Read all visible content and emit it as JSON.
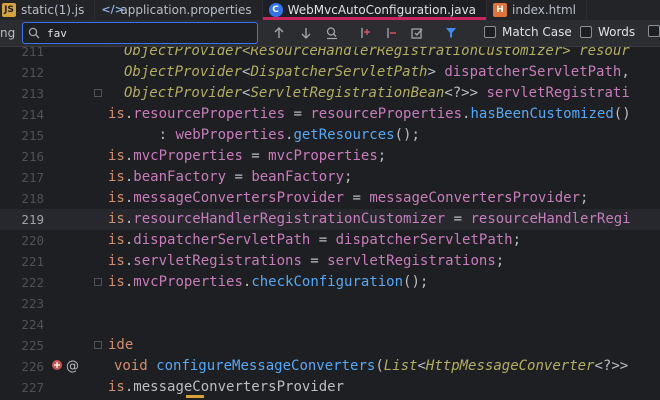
{
  "tabs": [
    {
      "label": "static(1).js",
      "icon": "js-file-icon",
      "icon_text": "JS",
      "active": false
    },
    {
      "label": "application.properties",
      "icon": "properties-file-icon",
      "icon_text": "</>",
      "active": false
    },
    {
      "label": "WebMvcAutoConfiguration.java",
      "icon": "java-class-icon",
      "icon_text": "C",
      "active": true
    },
    {
      "label": "index.html",
      "icon": "html-file-icon",
      "icon_text": "H",
      "active": false
    }
  ],
  "findbar": {
    "left_label": "ng",
    "query": "fav",
    "match_case_label": "Match Case",
    "words_label": "Words",
    "match_case_checked": false,
    "words_checked": false
  },
  "colors": {
    "background": "#1e1f22",
    "accent": "#3574f0",
    "active_tab_underline": "#c9245d",
    "keyword": "#cf8e6d",
    "field": "#c77dbb",
    "method": "#56a8f5",
    "type": "#b3ae60"
  },
  "editor": {
    "current_line": "219",
    "lines": [
      {
        "num": "211",
        "tokens": [
          [
            "ty",
            "ObjectProvider<ResourceHandlerRegistrationCustomizer> resour"
          ]
        ]
      },
      {
        "num": "212",
        "tokens": [
          [
            "ty",
            "ObjectProvider"
          ],
          [
            "pl",
            "<"
          ],
          [
            "ty",
            "DispatcherServletPath"
          ],
          [
            "pl",
            "> "
          ],
          [
            "fld",
            "dispatcherServletPath"
          ],
          [
            "pl",
            ","
          ]
        ]
      },
      {
        "num": "213",
        "tokens": [
          [
            "ty",
            "ObjectProvider"
          ],
          [
            "pl",
            "<"
          ],
          [
            "ty",
            "ServletRegistrationBean"
          ],
          [
            "pl",
            "<?>> "
          ],
          [
            "fld",
            "servletRegistrati"
          ]
        ]
      },
      {
        "num": "214",
        "tokens": [
          [
            "kw",
            "is"
          ],
          [
            "pl",
            "."
          ],
          [
            "fld",
            "resourceProperties"
          ],
          [
            "pl",
            " = "
          ],
          [
            "fld",
            "resourceProperties"
          ],
          [
            "pl",
            "."
          ],
          [
            "mth",
            "hasBeenCustomized"
          ],
          [
            "pl",
            "()"
          ]
        ]
      },
      {
        "num": "215",
        "tokens": [
          [
            "pl",
            "      : "
          ],
          [
            "fld",
            "webProperties"
          ],
          [
            "pl",
            "."
          ],
          [
            "mth",
            "getResources"
          ],
          [
            "pl",
            "();"
          ]
        ]
      },
      {
        "num": "216",
        "tokens": [
          [
            "kw",
            "is"
          ],
          [
            "pl",
            "."
          ],
          [
            "fld",
            "mvcProperties"
          ],
          [
            "pl",
            " = "
          ],
          [
            "fld",
            "mvcProperties"
          ],
          [
            "pl",
            ";"
          ]
        ]
      },
      {
        "num": "217",
        "tokens": [
          [
            "kw",
            "is"
          ],
          [
            "pl",
            "."
          ],
          [
            "fld",
            "beanFactory"
          ],
          [
            "pl",
            " = "
          ],
          [
            "fld",
            "beanFactory"
          ],
          [
            "pl",
            ";"
          ]
        ]
      },
      {
        "num": "218",
        "tokens": [
          [
            "kw",
            "is"
          ],
          [
            "pl",
            "."
          ],
          [
            "fld",
            "messageConvertersProvider"
          ],
          [
            "pl",
            " = "
          ],
          [
            "fld",
            "messageConvertersProvider"
          ],
          [
            "pl",
            ";"
          ]
        ]
      },
      {
        "num": "219",
        "tokens": [
          [
            "kw",
            "is"
          ],
          [
            "pl",
            "."
          ],
          [
            "fld",
            "resourceHandlerRegistrationCustomizer"
          ],
          [
            "pl",
            " = "
          ],
          [
            "fld",
            "resourceHandlerRegi"
          ]
        ]
      },
      {
        "num": "220",
        "tokens": [
          [
            "kw",
            "is"
          ],
          [
            "pl",
            "."
          ],
          [
            "fld",
            "dispatcherServletPath"
          ],
          [
            "pl",
            " = "
          ],
          [
            "fld",
            "dispatcherServletPath"
          ],
          [
            "pl",
            ";"
          ]
        ]
      },
      {
        "num": "221",
        "tokens": [
          [
            "kw",
            "is"
          ],
          [
            "pl",
            "."
          ],
          [
            "fld",
            "servletRegistrations"
          ],
          [
            "pl",
            " = "
          ],
          [
            "fld",
            "servletRegistrations"
          ],
          [
            "pl",
            ";"
          ]
        ]
      },
      {
        "num": "222",
        "tokens": [
          [
            "kw",
            "is"
          ],
          [
            "pl",
            "."
          ],
          [
            "fld",
            "mvcProperties"
          ],
          [
            "pl",
            "."
          ],
          [
            "mth",
            "checkConfiguration"
          ],
          [
            "pl",
            "();"
          ]
        ]
      },
      {
        "num": "223",
        "tokens": []
      },
      {
        "num": "224",
        "tokens": []
      },
      {
        "num": "225",
        "tokens": [
          [
            "kw",
            "ide"
          ]
        ]
      },
      {
        "num": "226",
        "tokens": [
          [
            "kw",
            "void "
          ],
          [
            "mth",
            "configureMessageConverters"
          ],
          [
            "pl",
            "("
          ],
          [
            "ty",
            "List"
          ],
          [
            "pl",
            "<"
          ],
          [
            "ty",
            "HttpMessageConverter"
          ],
          [
            "pl",
            "<?>>"
          ]
        ]
      },
      {
        "num": "227",
        "tokens": [
          [
            "kw",
            "is"
          ],
          [
            "pl",
            "."
          ],
          [
            "pl",
            "messageConvertersProvider"
          ]
        ]
      }
    ]
  }
}
